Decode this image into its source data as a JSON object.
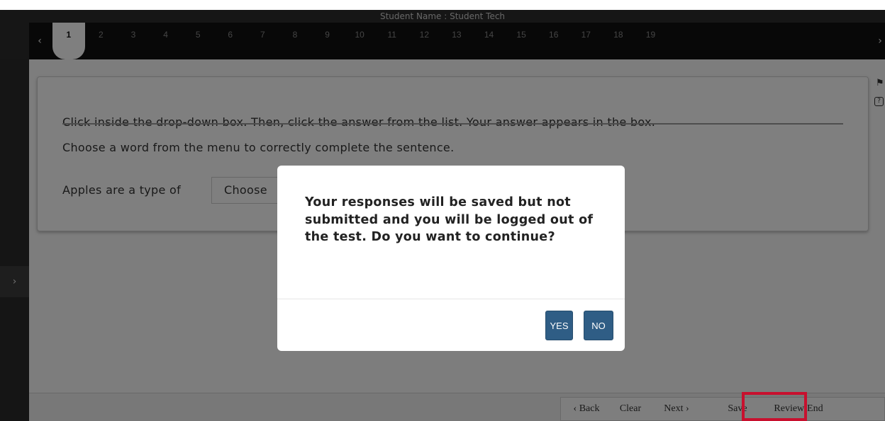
{
  "header": {
    "student_name": "Student Name : Student Tech",
    "left_arrow_icon": "chevron-left-icon",
    "right_arrow_icon": "chevron-right-icon",
    "questions": [
      "1",
      "2",
      "3",
      "4",
      "5",
      "6",
      "7",
      "8",
      "9",
      "10",
      "11",
      "12",
      "13",
      "14",
      "15",
      "16",
      "17",
      "18",
      "19"
    ],
    "active_question": "1"
  },
  "sidebar": {
    "toggle_icon": "chevron-right-icon"
  },
  "item": {
    "instruction": "Click inside the drop-down box. Then, click the answer from the list. Your answer appears in the box.",
    "prompt": "Choose a word from the menu to correctly complete the sentence.",
    "sentence_start": "Apples are a type of",
    "dropdown_value": "Choose"
  },
  "right_tools": {
    "mark_icon": "flag-icon",
    "help_icon": "help-icon"
  },
  "footer": {
    "back_label": "‹ Back",
    "clear_label": "Clear",
    "next_label": "Next ›",
    "save_label": "Save",
    "review_label": "Review/End"
  },
  "modal": {
    "message": "Your responses will be saved but not submitted and you will be logged out of the test. Do you want to continue?",
    "yes_label": "YES",
    "no_label": "NO"
  },
  "colors": {
    "modal_button": "#2f5d85",
    "highlight": "#c8102e",
    "header_bg": "#101010"
  }
}
